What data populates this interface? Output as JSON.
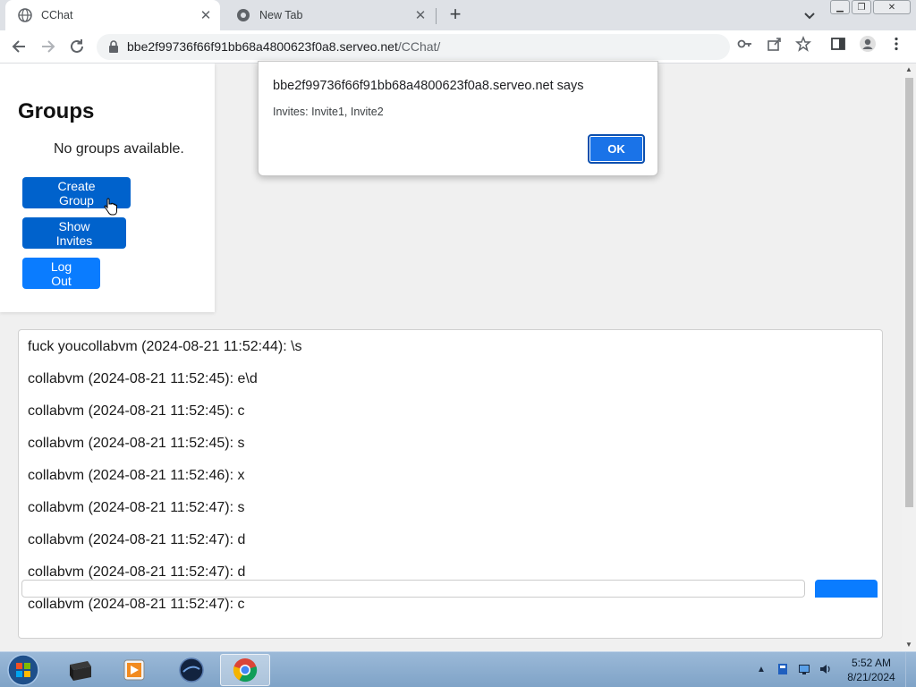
{
  "browser": {
    "tabs": [
      {
        "title": "CChat",
        "active": true
      },
      {
        "title": "New Tab",
        "active": false
      }
    ],
    "url_host": "bbe2f99736f66f91bb68a4800623f0a8.serveo.net",
    "url_path": "/CChat/"
  },
  "groups": {
    "heading": "Groups",
    "empty_text": "No groups available.",
    "create_label": "Create Group",
    "invites_label": "Show Invites",
    "logout_label": "Log Out"
  },
  "messages": [
    "fuck youcollabvm (2024-08-21 11:52:44): \\s",
    "collabvm (2024-08-21 11:52:45): e\\d",
    "collabvm (2024-08-21 11:52:45): c",
    "collabvm (2024-08-21 11:52:45): s",
    "collabvm (2024-08-21 11:52:46): x",
    "collabvm (2024-08-21 11:52:47): s",
    "collabvm (2024-08-21 11:52:47): d",
    "collabvm (2024-08-21 11:52:47): d",
    "collabvm (2024-08-21 11:52:47): c"
  ],
  "dialog": {
    "origin": "bbe2f99736f66f91bb68a4800623f0a8.serveo.net says",
    "message": "Invites: Invite1, Invite2",
    "ok_label": "OK"
  },
  "taskbar": {
    "time": "5:52 AM",
    "date": "8/21/2024"
  },
  "colors": {
    "primary_button": "#0a7cff",
    "dialog_ok": "#1a73e8"
  }
}
